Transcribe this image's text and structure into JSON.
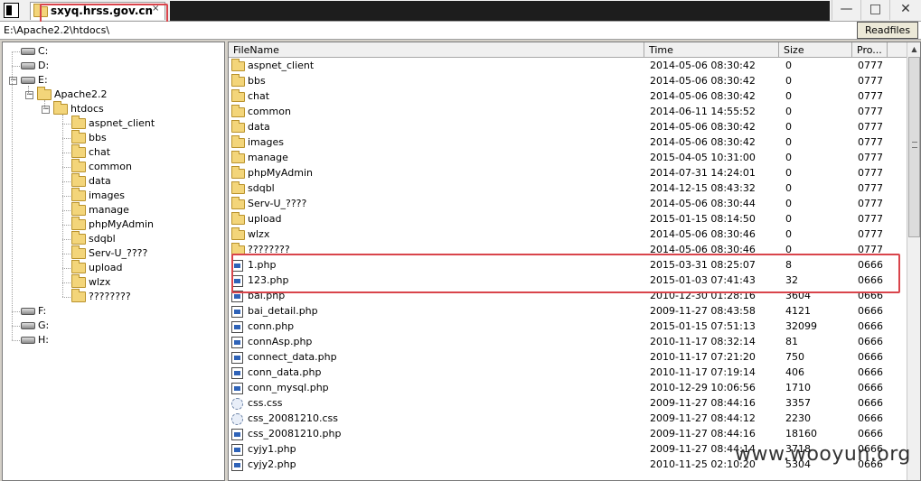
{
  "window": {
    "tab_title": "sxyq.hrss.gov.cn",
    "tab_close": "×",
    "minimize": "—",
    "maximize": "□",
    "close": "✕",
    "accent": "#d9444b"
  },
  "pathbar": {
    "path": "E:\\Apache2.2\\htdocs\\",
    "readfiles_label": "Readfiles"
  },
  "tree": {
    "drives": [
      "C:",
      "D:",
      "E:",
      "F:",
      "G:",
      "H:"
    ],
    "apache": "Apache2.2",
    "htdocs": "htdocs",
    "folders": [
      "aspnet_client",
      "bbs",
      "chat",
      "common",
      "data",
      "images",
      "manage",
      "phpMyAdmin",
      "sdqbl",
      "Serv-U_????",
      "upload",
      "wlzx",
      "????????"
    ]
  },
  "list": {
    "columns": [
      "FileName",
      "Time",
      "Size",
      "Pro..."
    ],
    "rows": [
      {
        "icon": "folder",
        "name": "aspnet_client",
        "time": "2014-05-06 08:30:42",
        "size": "0",
        "prop": "0777"
      },
      {
        "icon": "folder",
        "name": "bbs",
        "time": "2014-05-06 08:30:42",
        "size": "0",
        "prop": "0777"
      },
      {
        "icon": "folder",
        "name": "chat",
        "time": "2014-05-06 08:30:42",
        "size": "0",
        "prop": "0777"
      },
      {
        "icon": "folder",
        "name": "common",
        "time": "2014-06-11 14:55:52",
        "size": "0",
        "prop": "0777"
      },
      {
        "icon": "folder",
        "name": "data",
        "time": "2014-05-06 08:30:42",
        "size": "0",
        "prop": "0777"
      },
      {
        "icon": "folder",
        "name": "images",
        "time": "2014-05-06 08:30:42",
        "size": "0",
        "prop": "0777"
      },
      {
        "icon": "folder",
        "name": "manage",
        "time": "2015-04-05 10:31:00",
        "size": "0",
        "prop": "0777"
      },
      {
        "icon": "folder",
        "name": "phpMyAdmin",
        "time": "2014-07-31 14:24:01",
        "size": "0",
        "prop": "0777"
      },
      {
        "icon": "folder",
        "name": "sdqbl",
        "time": "2014-12-15 08:43:32",
        "size": "0",
        "prop": "0777"
      },
      {
        "icon": "folder",
        "name": "Serv-U_????",
        "time": "2014-05-06 08:30:44",
        "size": "0",
        "prop": "0777"
      },
      {
        "icon": "folder",
        "name": "upload",
        "time": "2015-01-15 08:14:50",
        "size": "0",
        "prop": "0777"
      },
      {
        "icon": "folder",
        "name": "wlzx",
        "time": "2014-05-06 08:30:46",
        "size": "0",
        "prop": "0777"
      },
      {
        "icon": "folder",
        "name": "????????",
        "time": "2014-05-06 08:30:46",
        "size": "0",
        "prop": "0777"
      },
      {
        "icon": "php",
        "name": "1.php",
        "time": "2015-03-31 08:25:07",
        "size": "8",
        "prop": "0666"
      },
      {
        "icon": "php",
        "name": "123.php",
        "time": "2015-01-03 07:41:43",
        "size": "32",
        "prop": "0666"
      },
      {
        "icon": "php",
        "name": "bai.php",
        "time": "2010-12-30 01:28:16",
        "size": "3604",
        "prop": "0666"
      },
      {
        "icon": "php",
        "name": "bai_detail.php",
        "time": "2009-11-27 08:43:58",
        "size": "4121",
        "prop": "0666"
      },
      {
        "icon": "php",
        "name": "conn.php",
        "time": "2015-01-15 07:51:13",
        "size": "32099",
        "prop": "0666"
      },
      {
        "icon": "php",
        "name": "connAsp.php",
        "time": "2010-11-17 08:32:14",
        "size": "81",
        "prop": "0666"
      },
      {
        "icon": "php",
        "name": "connect_data.php",
        "time": "2010-11-17 07:21:20",
        "size": "750",
        "prop": "0666"
      },
      {
        "icon": "php",
        "name": "conn_data.php",
        "time": "2010-11-17 07:19:14",
        "size": "406",
        "prop": "0666"
      },
      {
        "icon": "php",
        "name": "conn_mysql.php",
        "time": "2010-12-29 10:06:56",
        "size": "1710",
        "prop": "0666"
      },
      {
        "icon": "css",
        "name": "css.css",
        "time": "2009-11-27 08:44:16",
        "size": "3357",
        "prop": "0666"
      },
      {
        "icon": "css",
        "name": "css_20081210.css",
        "time": "2009-11-27 08:44:12",
        "size": "2230",
        "prop": "0666"
      },
      {
        "icon": "php",
        "name": "css_20081210.php",
        "time": "2009-11-27 08:44:16",
        "size": "18160",
        "prop": "0666"
      },
      {
        "icon": "php",
        "name": "cyjy1.php",
        "time": "2009-11-27 08:44:14",
        "size": "3718",
        "prop": "0666"
      },
      {
        "icon": "php",
        "name": "cyjy2.php",
        "time": "2010-11-25 02:10:20",
        "size": "5304",
        "prop": "0666"
      }
    ]
  },
  "watermark": "www.wooyun.org"
}
